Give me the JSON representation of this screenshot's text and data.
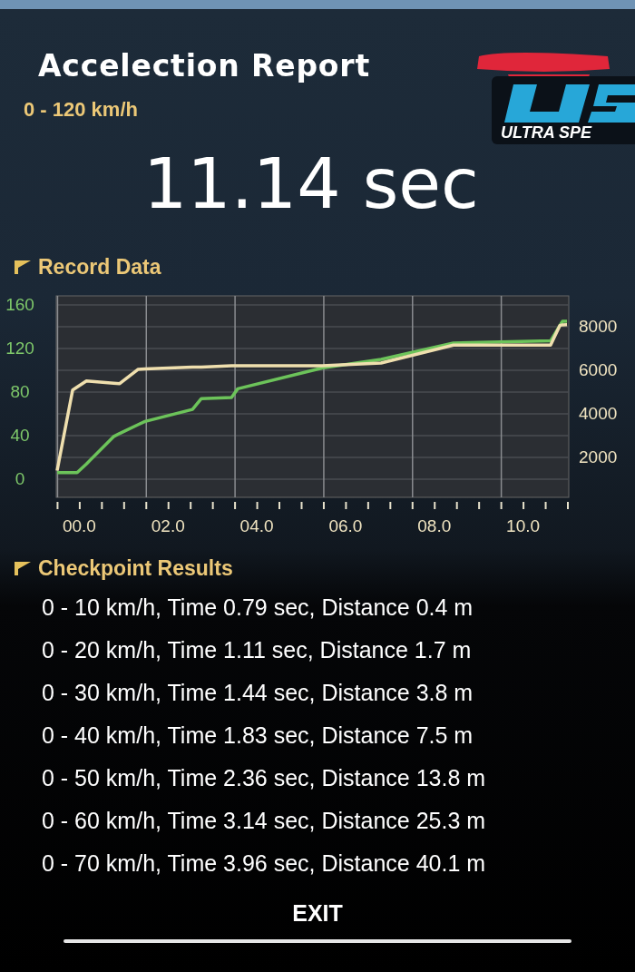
{
  "title": "Accelection Report",
  "brand_logo": {
    "text": "ULTRA SPE"
  },
  "range": "0 - 120 km/h",
  "result": "11.14 sec",
  "record_section": {
    "title": "Record Data",
    "chart_data": {
      "type": "line",
      "grid": true,
      "xlim": [
        -0.52,
        11.03
      ],
      "ylim": [
        -16.7,
        168.3
      ],
      "y2lim": [
        167,
        9384
      ],
      "x": [
        -0.5,
        -0.15,
        -0.05,
        0.16,
        0.77,
        0.91,
        1.32,
        1.48,
        2.55,
        2.75,
        3.43,
        3.57,
        5.47,
        6.8,
        8.43,
        10.62,
        10.83,
        10.89,
        10.99
      ],
      "xticks": [
        {
          "value": 0,
          "label": "00.0"
        },
        {
          "value": 2,
          "label": "02.0"
        },
        {
          "value": 4,
          "label": "04.0"
        },
        {
          "value": 6,
          "label": "06.0"
        },
        {
          "value": 8,
          "label": "08.0"
        },
        {
          "value": 10,
          "label": "10.0"
        }
      ],
      "yticks": [
        0,
        40,
        80,
        120,
        160
      ],
      "y2ticks": [
        2000,
        4000,
        6000,
        8000
      ],
      "series": [
        {
          "color": "#6cc35a",
          "values": [
            6,
            6,
            6,
            14,
            39,
            42,
            50,
            53,
            64,
            74,
            75,
            83,
            102,
            110,
            125,
            127,
            141,
            145,
            145
          ]
        },
        {
          "color": "#efdfae",
          "axis": "y2",
          "values": [
            1390,
            5080,
            5210,
            5490,
            5390,
            5370,
            6020,
            6040,
            6120,
            6130,
            6190,
            6190,
            6190,
            6310,
            7130,
            7130,
            8030,
            8060,
            8070
          ]
        }
      ]
    }
  },
  "checkpoint_section": {
    "title": "Checkpoint Results",
    "rows": [
      "0 - 10 km/h, Time 0.79 sec, Distance 0.4 m",
      "0 - 20 km/h, Time 1.11 sec, Distance 1.7 m",
      "0 - 30 km/h, Time 1.44 sec, Distance 3.8 m",
      "0 - 40 km/h, Time 1.83 sec, Distance 7.5 m",
      "0 - 50 km/h, Time 2.36 sec, Distance 13.8 m",
      "0 - 60 km/h, Time 3.14 sec, Distance 25.3 m",
      "0 - 70 km/h, Time 3.96 sec, Distance 40.1 m"
    ]
  },
  "exit_button": "EXIT"
}
